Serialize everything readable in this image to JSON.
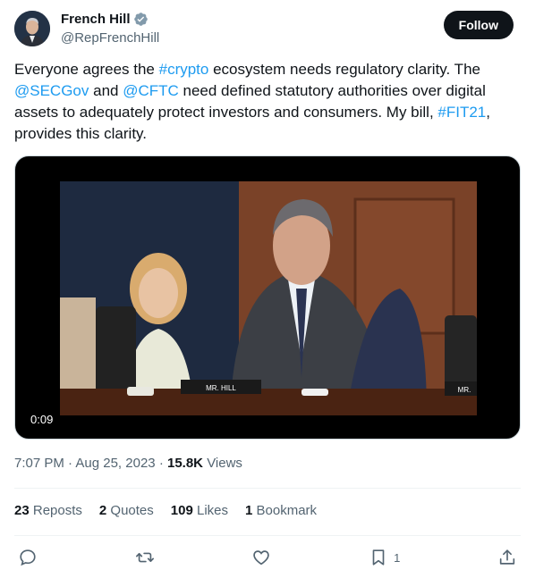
{
  "author": {
    "display_name": "French Hill",
    "handle": "@RepFrenchHill",
    "follow_label": "Follow"
  },
  "tweet": {
    "segments": [
      {
        "text": "Everyone agrees the ",
        "type": "text"
      },
      {
        "text": "#crypto",
        "type": "link"
      },
      {
        "text": " ecosystem needs regulatory clarity. The ",
        "type": "text"
      },
      {
        "text": "@SECGov",
        "type": "link"
      },
      {
        "text": " and ",
        "type": "text"
      },
      {
        "text": "@CFTC",
        "type": "link"
      },
      {
        "text": " need defined statutory authorities over digital assets to adequately protect investors and consumers.  My bill, ",
        "type": "text"
      },
      {
        "text": "#FIT21",
        "type": "link"
      },
      {
        "text": ", provides this clarity.",
        "type": "text"
      }
    ],
    "video_time": "0:09",
    "nameplate_left": "MR. HILL",
    "nameplate_right": "MR."
  },
  "meta": {
    "time": "7:07 PM",
    "date": "Aug 25, 2023",
    "views_count": "15.8K",
    "views_label": "Views"
  },
  "stats": {
    "reposts_count": "23",
    "reposts_label": "Reposts",
    "quotes_count": "2",
    "quotes_label": "Quotes",
    "likes_count": "109",
    "likes_label": "Likes",
    "bookmarks_count": "1",
    "bookmarks_label": "Bookmark"
  },
  "actions": {
    "bookmark_count": "1"
  },
  "colors": {
    "link": "#1d9bf0",
    "verified": "#829aab",
    "primary_text": "#0f1419",
    "secondary_text": "#536471"
  }
}
